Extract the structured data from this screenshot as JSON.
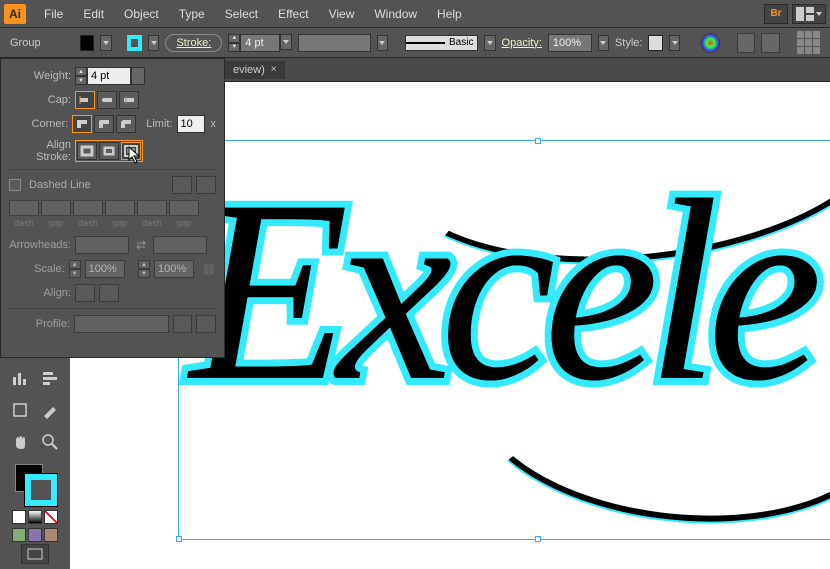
{
  "app": {
    "icon_label": "Ai"
  },
  "menu": {
    "items": [
      "File",
      "Edit",
      "Object",
      "Type",
      "Select",
      "Effect",
      "View",
      "Window",
      "Help"
    ]
  },
  "control": {
    "mode": "Group",
    "fill_color": "#000000",
    "stroke_color": "#33eaff",
    "stroke_link": "Stroke:",
    "stroke_size": "4 pt",
    "brush_label": "Basic",
    "opacity_label": "Opacity:",
    "opacity_value": "100%",
    "style_label": "Style:"
  },
  "tab": {
    "title_fragment": "eview)",
    "close": "×"
  },
  "stroke_panel": {
    "weight_label": "Weight:",
    "weight_value": "4 pt",
    "cap_label": "Cap:",
    "corner_label": "Corner:",
    "limit_label": "Limit:",
    "limit_value": "10",
    "limit_x": "x",
    "align_label": "Align Stroke:",
    "dashed_label": "Dashed Line",
    "dash_labels": [
      "dash",
      "gap",
      "dash",
      "gap",
      "dash",
      "gap"
    ],
    "arrow_label": "Arrowheads:",
    "scale_label": "Scale:",
    "scale_a": "100%",
    "scale_b": "100%",
    "align_arrows_label": "Align:",
    "profile_label": "Profile:"
  },
  "canvas": {
    "text": "Excele"
  },
  "colors": {
    "accent": "#f7931e",
    "cyan": "#33eaff"
  }
}
